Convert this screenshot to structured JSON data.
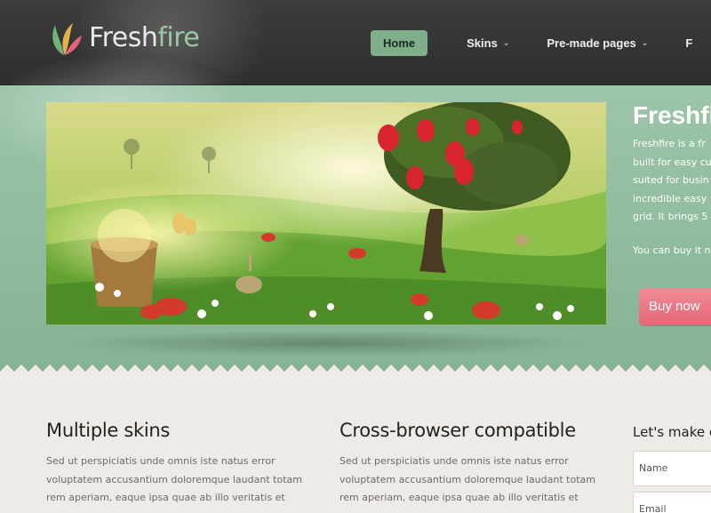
{
  "header": {
    "logo": {
      "part1": "Fresh",
      "part2": "fire"
    },
    "nav": [
      {
        "label": "Home",
        "active": true
      },
      {
        "label": "Skins",
        "dropdown": true
      },
      {
        "label": "Pre-made pages",
        "dropdown": true
      },
      {
        "label": "F"
      }
    ]
  },
  "hero": {
    "title": "Freshfi",
    "lines": [
      "Freshfire is a fr",
      "built for easy cu",
      "suited for busin",
      "incredible easy",
      "grid. It brings 5"
    ],
    "buy_text": "You can buy it n",
    "buy_button": "Buy now"
  },
  "features": [
    {
      "title": "Multiple skins",
      "lines": [
        "Sed ut perspiciatis unde omnis iste natus error",
        "voluptatem accusantium doloremque laudant totam",
        "rem aperiam, eaque ipsa quae ab illo veritatis et"
      ]
    },
    {
      "title": "Cross-browser compatible",
      "lines": [
        "Sed ut perspiciatis unde omnis iste natus error",
        "voluptatem accusantium doloremque laudant totam",
        "rem aperiam, eaque ipsa quae ab illo veritatis et"
      ]
    }
  ],
  "contact": {
    "title": "Let's make c",
    "name_placeholder": "Name",
    "email_placeholder": "Email"
  },
  "colors": {
    "header_bg": "#333333",
    "accent_green": "#7fae8a",
    "hero_bg": "#8fbb9d",
    "buy_button": "#e96b7b",
    "page_bg": "#eeebe6"
  }
}
